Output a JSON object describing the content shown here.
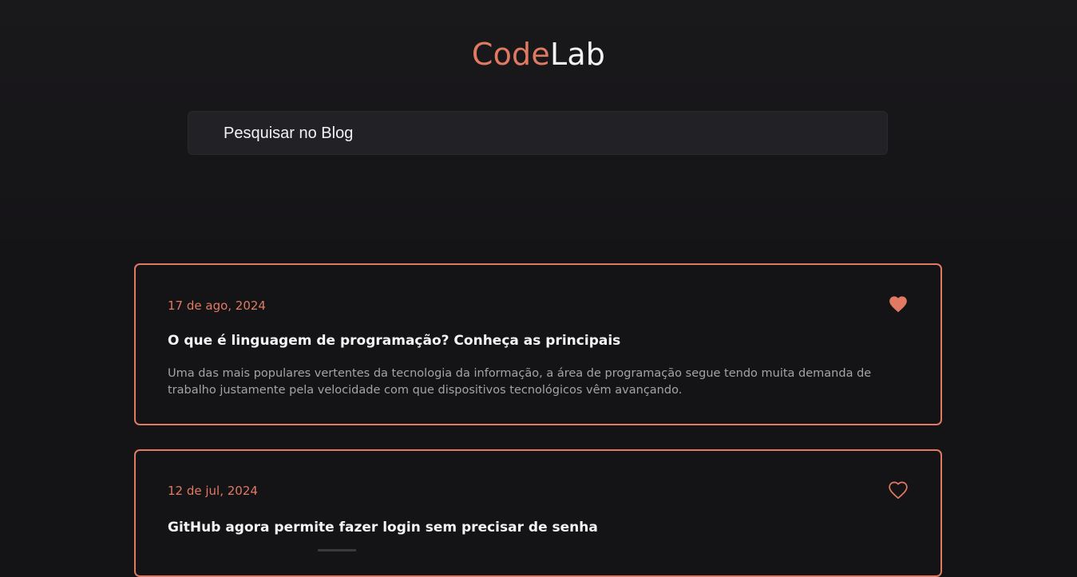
{
  "brand": {
    "part1": "Code",
    "part2": "Lab",
    "accent_color": "#e07a63"
  },
  "search": {
    "placeholder": "Pesquisar no Blog",
    "value": ""
  },
  "posts": [
    {
      "date": "17 de ago, 2024",
      "title": "O que é linguagem de programação? Conheça as principais",
      "excerpt": "Uma das mais populares vertentes da tecnologia da informação, a área de programação segue tendo muita demanda de trabalho justamente pela velocidade com que dispositivos tecnológicos vêm avançando.",
      "liked": true,
      "icon": "heart-filled-icon"
    },
    {
      "date": "12 de jul, 2024",
      "title": "GitHub agora permite fazer login sem precisar de senha",
      "liked": false,
      "icon": "heart-outline-icon"
    }
  ]
}
